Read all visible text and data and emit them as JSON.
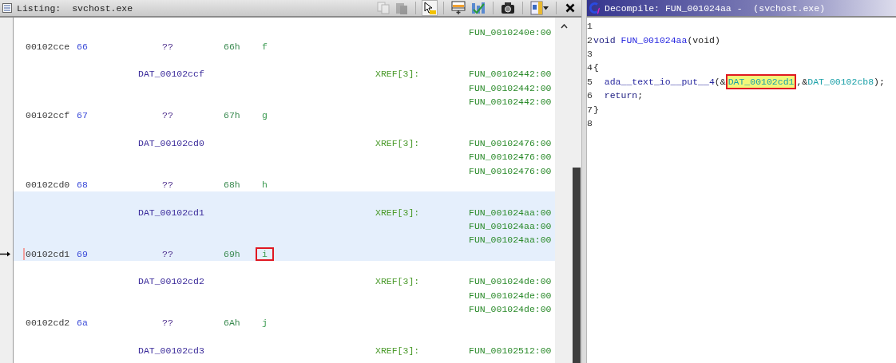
{
  "listing": {
    "title": "Listing:",
    "program": "svchost.exe",
    "toolbar": [
      {
        "kind": "copy",
        "disabled": true,
        "pressed": false
      },
      {
        "kind": "paste",
        "disabled": true,
        "pressed": false
      },
      {
        "kind": "pointer",
        "disabled": false,
        "pressed": true
      },
      {
        "kind": "table",
        "disabled": false,
        "pressed": false
      },
      {
        "kind": "chart",
        "disabled": false,
        "pressed": false
      },
      {
        "kind": "camera",
        "disabled": false,
        "pressed": false
      },
      {
        "kind": "layout",
        "disabled": false,
        "pressed": false
      },
      {
        "kind": "close",
        "disabled": false,
        "pressed": false
      }
    ],
    "units": [
      {
        "xrefs": [
          "FUN_0010240e:00"
        ],
        "address": "00102cce",
        "bytes": "66",
        "mnemonic": "??",
        "value": "66h",
        "char": "f",
        "selected": false,
        "cursor": false,
        "char_annotated": false
      },
      {
        "label": "DAT_00102ccf",
        "xref_label": "XREF[3]:",
        "xrefs": [
          "FUN_00102442:00",
          "FUN_00102442:00",
          "FUN_00102442:00"
        ],
        "address": "00102ccf",
        "bytes": "67",
        "mnemonic": "??",
        "value": "67h",
        "char": "g",
        "selected": false,
        "cursor": false,
        "char_annotated": false
      },
      {
        "label": "DAT_00102cd0",
        "xref_label": "XREF[3]:",
        "xrefs": [
          "FUN_00102476:00",
          "FUN_00102476:00",
          "FUN_00102476:00"
        ],
        "address": "00102cd0",
        "bytes": "68",
        "mnemonic": "??",
        "value": "68h",
        "char": "h",
        "selected": false,
        "cursor": false,
        "char_annotated": false
      },
      {
        "label": "DAT_00102cd1",
        "xref_label": "XREF[3]:",
        "xrefs": [
          "FUN_001024aa:00",
          "FUN_001024aa:00",
          "FUN_001024aa:00"
        ],
        "address": "00102cd1",
        "bytes": "69",
        "mnemonic": "??",
        "value": "69h",
        "char": "i",
        "selected": true,
        "cursor": true,
        "char_annotated": true
      },
      {
        "label": "DAT_00102cd2",
        "xref_label": "XREF[3]:",
        "xrefs": [
          "FUN_001024de:00",
          "FUN_001024de:00",
          "FUN_001024de:00"
        ],
        "address": "00102cd2",
        "bytes": "6a",
        "mnemonic": "??",
        "value": "6Ah",
        "char": "j",
        "selected": false,
        "cursor": false,
        "char_annotated": false
      },
      {
        "label": "DAT_00102cd3",
        "xref_label": "XREF[3]:",
        "xrefs": [
          "FUN_00102512:00"
        ],
        "selected": false
      }
    ]
  },
  "decompile": {
    "title": "Decompile: FUN_001024aa -  (svchost.exe)",
    "lines": [
      {
        "number": "1"
      },
      {
        "number": "2",
        "tokens": [
          {
            "kind": "keyword",
            "text": "void",
            "highlighted": false,
            "annotated": false
          },
          {
            "kind": "function",
            "text": "FUN_001024aa",
            "highlighted": false,
            "annotated": false
          },
          {
            "kind": "plain",
            "text": "(void)",
            "highlighted": false,
            "annotated": false
          }
        ]
      },
      {
        "number": "3"
      },
      {
        "number": "4",
        "tokens": [
          {
            "kind": "plain",
            "text": "{",
            "highlighted": false,
            "annotated": false
          }
        ]
      },
      {
        "number": "5",
        "tokens": [
          {
            "kind": "call",
            "text": "  ada__text_io__put__4",
            "highlighted": false,
            "annotated": false
          },
          {
            "kind": "plain",
            "text": "(&",
            "highlighted": false,
            "annotated": false
          },
          {
            "kind": "data",
            "text": "DAT_00102cd1",
            "highlighted": true,
            "annotated": true
          },
          {
            "kind": "plain",
            "text": ",&",
            "highlighted": false,
            "annotated": false
          },
          {
            "kind": "data",
            "text": "DAT_00102cb8",
            "highlighted": false,
            "annotated": false
          },
          {
            "kind": "plain",
            "text": ");",
            "highlighted": false,
            "annotated": false
          }
        ]
      },
      {
        "number": "6",
        "tokens": [
          {
            "kind": "keyword",
            "text": "  return",
            "highlighted": false,
            "annotated": false
          },
          {
            "kind": "plain",
            "text": ";",
            "highlighted": false,
            "annotated": false
          }
        ]
      },
      {
        "number": "7",
        "tokens": [
          {
            "kind": "plain",
            "text": "}",
            "highlighted": false,
            "annotated": false
          }
        ]
      },
      {
        "number": "8"
      }
    ]
  }
}
